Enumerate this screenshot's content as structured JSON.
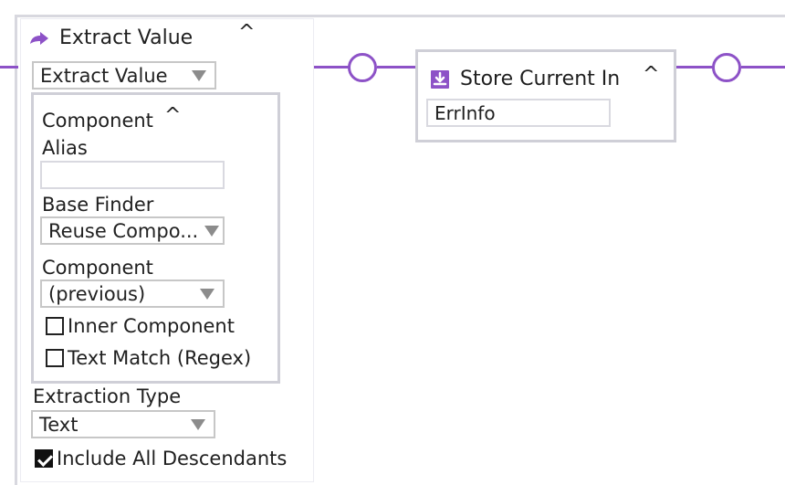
{
  "colors": {
    "accent": "#8d52c7",
    "border": "#cfcfd7",
    "text": "#1f1f1f"
  },
  "extract_value": {
    "title": "Extract Value",
    "icon": "forward-arrow-icon",
    "dropdown_value": "Extract Value",
    "component_section": {
      "title": "Component",
      "alias_label": "Alias",
      "alias_value": "",
      "base_finder_label": "Base Finder",
      "base_finder_value": "Reuse Compo...",
      "component_label": "Component",
      "component_value": "(previous)",
      "inner_component_label": "Inner Component",
      "inner_component_checked": false,
      "text_match_label": "Text Match (Regex)",
      "text_match_checked": false
    },
    "extraction_type_label": "Extraction Type",
    "extraction_type_value": "Text",
    "include_all_descendants_label": "Include All Descendants",
    "include_all_descendants_checked": true
  },
  "store_current_in": {
    "title": "Store Current In",
    "icon": "download-box-icon",
    "value": "ErrInfo"
  }
}
